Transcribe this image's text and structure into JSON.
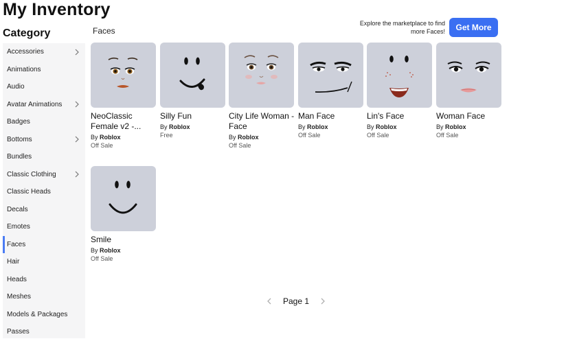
{
  "page": {
    "title": "My Inventory"
  },
  "sidebar": {
    "heading": "Category",
    "items": [
      {
        "label": "Accessories",
        "chevron": true
      },
      {
        "label": "Animations",
        "chevron": false
      },
      {
        "label": "Audio",
        "chevron": false
      },
      {
        "label": "Avatar Animations",
        "chevron": true
      },
      {
        "label": "Badges",
        "chevron": false
      },
      {
        "label": "Bottoms",
        "chevron": true
      },
      {
        "label": "Bundles",
        "chevron": false
      },
      {
        "label": "Classic Clothing",
        "chevron": true
      },
      {
        "label": "Classic Heads",
        "chevron": false
      },
      {
        "label": "Decals",
        "chevron": false
      },
      {
        "label": "Emotes",
        "chevron": false
      },
      {
        "label": "Faces",
        "chevron": false,
        "active": true
      },
      {
        "label": "Hair",
        "chevron": false
      },
      {
        "label": "Heads",
        "chevron": false
      },
      {
        "label": "Meshes",
        "chevron": false
      },
      {
        "label": "Models & Packages",
        "chevron": false
      },
      {
        "label": "Passes",
        "chevron": false
      }
    ]
  },
  "main": {
    "section_title": "Faces",
    "promo_text": "Explore the marketplace to find more Faces!",
    "get_more_label": "Get More",
    "by_prefix": "By",
    "items": [
      {
        "name": "NeoClassic Female v2 -...",
        "creator": "Roblox",
        "price": "Off Sale",
        "face": "neoclassic-female"
      },
      {
        "name": "Silly Fun",
        "creator": "Roblox",
        "price": "Free",
        "face": "silly-fun"
      },
      {
        "name": "City Life Woman - Face",
        "creator": "Roblox",
        "price": "Off Sale",
        "face": "city-life-woman"
      },
      {
        "name": "Man Face",
        "creator": "Roblox",
        "price": "Off Sale",
        "face": "man-face"
      },
      {
        "name": "Lin's Face",
        "creator": "Roblox",
        "price": "Off Sale",
        "face": "lins-face"
      },
      {
        "name": "Woman Face",
        "creator": "Roblox",
        "price": "Off Sale",
        "face": "woman-face"
      },
      {
        "name": "Smile",
        "creator": "Roblox",
        "price": "Off Sale",
        "face": "smile"
      }
    ]
  },
  "pagination": {
    "label": "Page 1"
  },
  "colors": {
    "accent": "#3a6ff2",
    "thumb_bg": "#cdd0da",
    "sidebar_bg": "#f5f5f6",
    "active_bar": "#4b7cf4"
  }
}
